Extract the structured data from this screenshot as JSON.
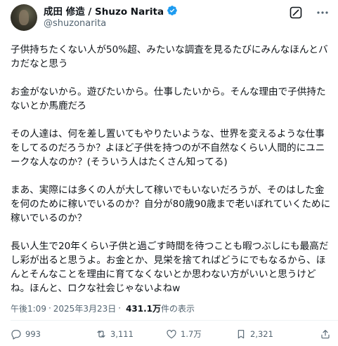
{
  "author": {
    "display_name": "成田 修造 / Shuzo Narita",
    "handle": "@shuzonarita",
    "avatar_icon": "profile-photo",
    "verified_icon": "verified-badge-icon",
    "verified_color": "#1d9bf0"
  },
  "post": {
    "paragraphs": [
      "子供持ちたくない人が50%超、みたいな調査を見るたびにみんなほんとバカだなと思う",
      "お金がないから。遊びたいから。仕事したいから。そんな理由で子供持たないとか馬鹿だろ",
      "その人達は、何を差し置いてもやりたいような、世界を変えるような仕事をしてるのだろうか？よほど子供を持つのが不自然なくらい人間的にユニークな人なのか？(そういう人はたくさん知ってる)",
      "まあ、実際には多くの人が大して稼いでもいないだろうが、そのはした金を何のために稼いでいるのか？自分が80歳90歳まで老いぼれていくために稼いでいるのか？",
      "長い人生で20年くらい子供と過ごす時間を待つことも暇つぶしにも最高だし彩が出ると思うよ。お金とか、見栄を捨てればどうにでもなるから、ほんとそんなことを理由に育てなくないとか思わない方がいいと思うけどね。ほんと、ロクな社会じゃないよねw"
    ]
  },
  "meta": {
    "time": "午後1:09",
    "separator": "·",
    "date": "2025年3月23日",
    "views_count": "431.1万",
    "views_label": "件の表示"
  },
  "actions": {
    "replies": "993",
    "reposts": "3,111",
    "likes": "1.7万",
    "bookmarks": "2,321"
  }
}
